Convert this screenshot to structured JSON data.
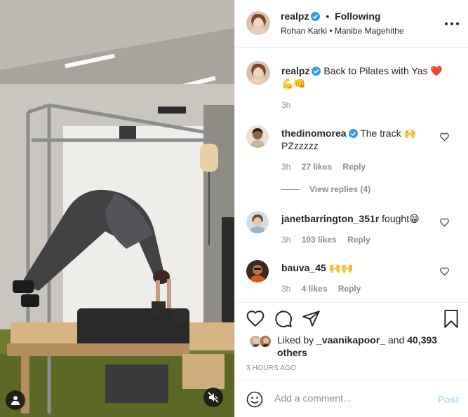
{
  "post": {
    "author": "realpz",
    "separator": "•",
    "follow_status": "Following",
    "subtitle": "Rohan Karki • Manibe Magehithe",
    "caption": {
      "username": "realpz",
      "text": "Back to Pilates with Yas",
      "emojis": "❤️ 💪👊",
      "time": "3h"
    }
  },
  "comments": [
    {
      "username": "thedinomorea",
      "text": "The track 🙌 PZzzzzz",
      "time": "3h",
      "likes": "27 likes",
      "reply": "Reply",
      "view_replies": "View replies (4)"
    },
    {
      "username": "janetbarrington_351r",
      "text": "fought😁",
      "time": "3h",
      "likes": "103 likes",
      "reply": "Reply"
    },
    {
      "username": "bauva_45",
      "text": "🙌🙌",
      "time": "3h",
      "likes": "4 likes",
      "reply": "Reply"
    }
  ],
  "likes": {
    "prefix": "Liked by",
    "user": "_vaanikapoor_",
    "conj": "and",
    "others": "40,393 others"
  },
  "time_ago": "3 HOURS AGO",
  "comment_box": {
    "placeholder": "Add a comment...",
    "post_label": "Post"
  },
  "icons": {
    "user": "user-tag-icon",
    "mute": "mute-icon",
    "more": "more-options-icon",
    "like": "heart-icon",
    "comment": "comment-icon",
    "share": "share-icon",
    "save": "bookmark-icon",
    "emoji": "emoji-icon",
    "verified": "verified-badge-icon"
  },
  "colors": {
    "verified": "#3897f0",
    "link_disabled": "#b2dffc",
    "muted_text": "#8e8e8e",
    "heart": "#ed4956"
  }
}
